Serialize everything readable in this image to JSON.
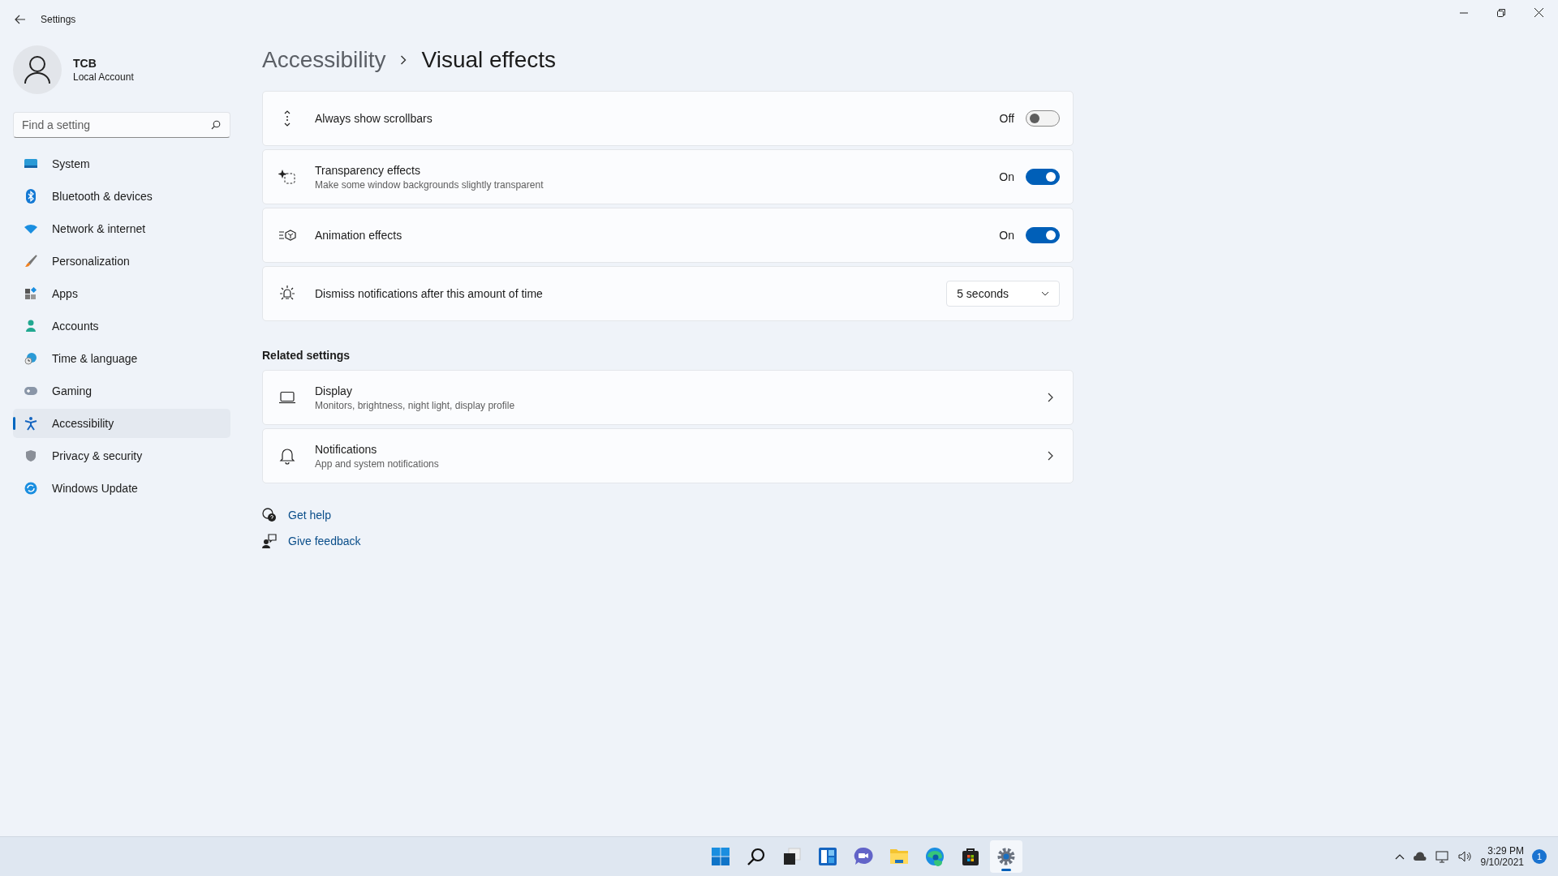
{
  "window": {
    "title": "Settings"
  },
  "account": {
    "name": "TCB",
    "type": "Local Account"
  },
  "search": {
    "placeholder": "Find a setting"
  },
  "nav": [
    {
      "label": "System",
      "selected": false
    },
    {
      "label": "Bluetooth & devices",
      "selected": false
    },
    {
      "label": "Network & internet",
      "selected": false
    },
    {
      "label": "Personalization",
      "selected": false
    },
    {
      "label": "Apps",
      "selected": false
    },
    {
      "label": "Accounts",
      "selected": false
    },
    {
      "label": "Time & language",
      "selected": false
    },
    {
      "label": "Gaming",
      "selected": false
    },
    {
      "label": "Accessibility",
      "selected": true
    },
    {
      "label": "Privacy & security",
      "selected": false
    },
    {
      "label": "Windows Update",
      "selected": false
    }
  ],
  "breadcrumb": [
    "Accessibility",
    "Visual effects"
  ],
  "settings": [
    {
      "kind": "toggle",
      "title": "Always show scrollbars",
      "state_label": "Off",
      "on": false
    },
    {
      "kind": "toggle",
      "title": "Transparency effects",
      "description": "Make some window backgrounds slightly transparent",
      "state_label": "On",
      "on": true
    },
    {
      "kind": "toggle",
      "title": "Animation effects",
      "state_label": "On",
      "on": true
    },
    {
      "kind": "dropdown",
      "title": "Dismiss notifications after this amount of time",
      "value": "5 seconds"
    }
  ],
  "related": {
    "heading": "Related settings",
    "items": [
      {
        "title": "Display",
        "description": "Monitors, brightness, night light, display profile"
      },
      {
        "title": "Notifications",
        "description": "App and system notifications"
      }
    ]
  },
  "help_links": [
    {
      "label": "Get help"
    },
    {
      "label": "Give feedback"
    }
  ],
  "taskbar": {
    "apps": [
      {
        "selected": false
      },
      {
        "selected": false
      },
      {
        "selected": false
      },
      {
        "selected": false
      },
      {
        "selected": false
      },
      {
        "selected": false
      },
      {
        "selected": false
      },
      {
        "selected": false
      },
      {
        "selected": true
      }
    ]
  },
  "tray": {
    "time": "3:29 PM",
    "date": "9/10/2021",
    "badge": "1"
  }
}
